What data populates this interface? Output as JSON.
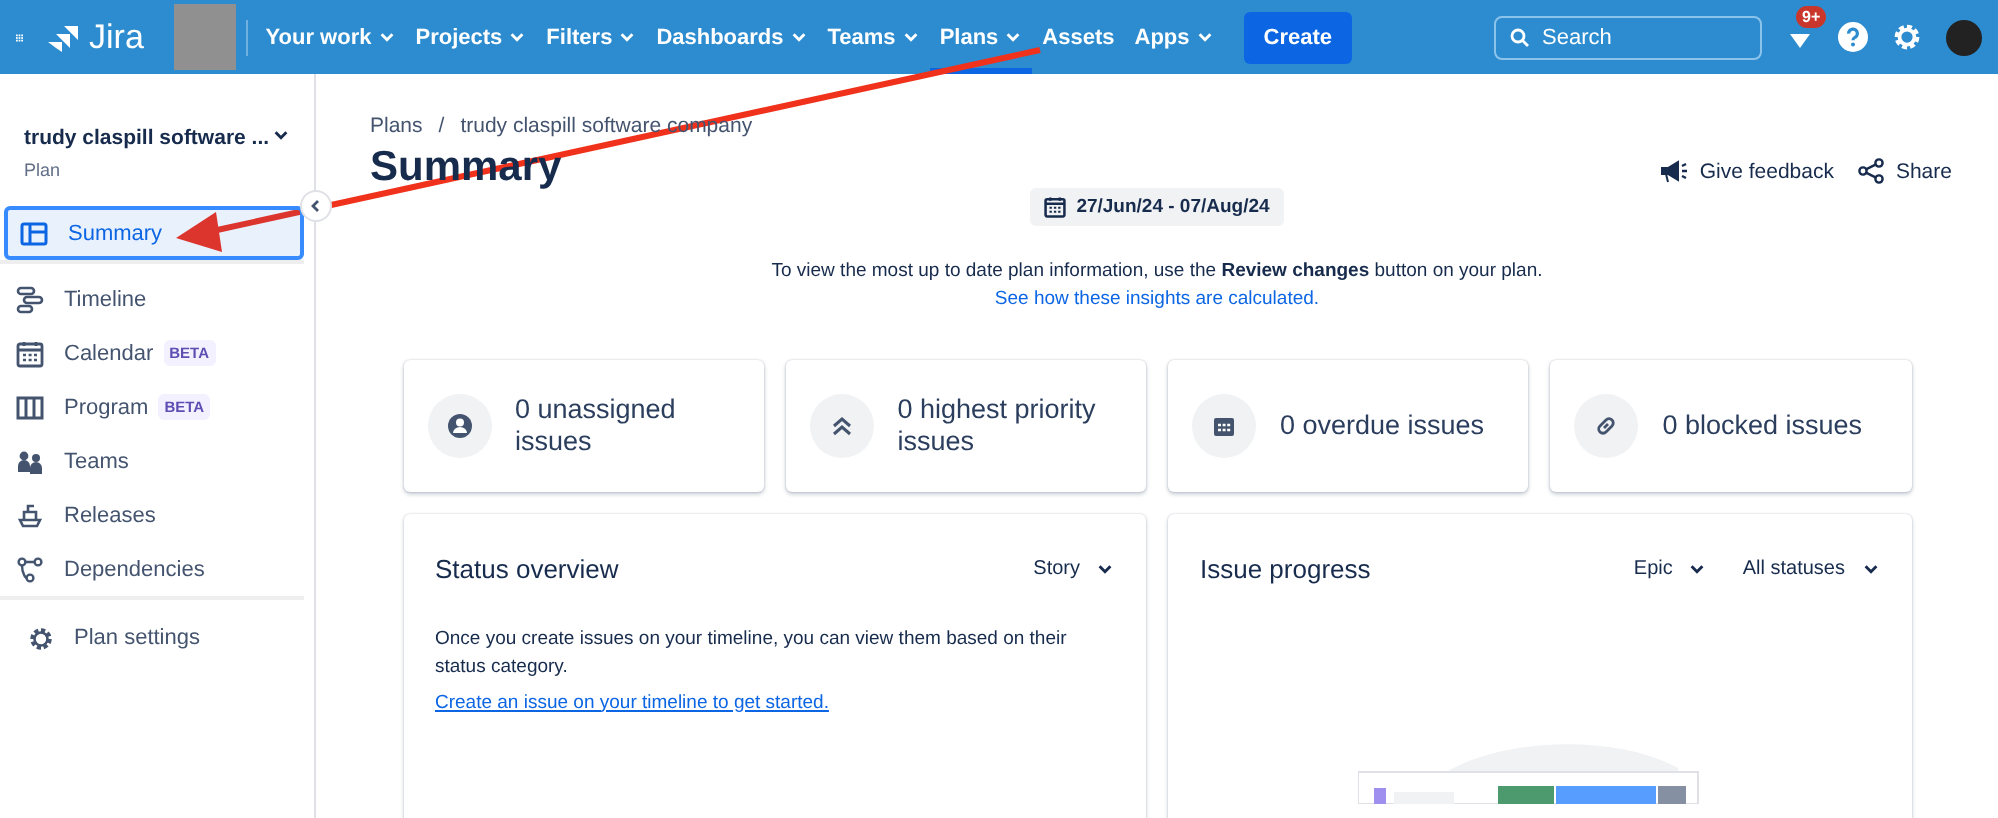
{
  "top_nav": {
    "product": "Jira",
    "menus": [
      {
        "label": "Your work",
        "dropdown": true,
        "selected": false
      },
      {
        "label": "Projects",
        "dropdown": true,
        "selected": false
      },
      {
        "label": "Filters",
        "dropdown": true,
        "selected": false
      },
      {
        "label": "Dashboards",
        "dropdown": true,
        "selected": false
      },
      {
        "label": "Teams",
        "dropdown": true,
        "selected": false
      },
      {
        "label": "Plans",
        "dropdown": true,
        "selected": true
      },
      {
        "label": "Assets",
        "dropdown": false,
        "selected": false
      },
      {
        "label": "Apps",
        "dropdown": true,
        "selected": false
      }
    ],
    "create": "Create",
    "search": {
      "placeholder": "Search"
    },
    "notification_badge": "9+"
  },
  "sidebar": {
    "plan_name": "trudy claspill software ...",
    "plan_type": "Plan",
    "items": [
      {
        "label": "Summary",
        "selected": true
      },
      {
        "label": "Timeline",
        "selected": false
      },
      {
        "label": "Calendar",
        "badge": "BETA",
        "selected": false
      },
      {
        "label": "Program",
        "badge": "BETA",
        "selected": false
      },
      {
        "label": "Teams",
        "selected": false
      },
      {
        "label": "Releases",
        "selected": false
      },
      {
        "label": "Dependencies",
        "selected": false
      }
    ],
    "settings": "Plan settings"
  },
  "breadcrumbs": [
    "Plans",
    "trudy claspill software company"
  ],
  "breadcrumb_separator": "/",
  "page_title": "Summary",
  "actions": [
    "Give feedback",
    "Share"
  ],
  "date_range": "27/Jun/24 - 07/Aug/24",
  "info": "To view the most up to date plan information, use the **Review changes** button on your plan.",
  "info_link": "See how these insights are calculated.",
  "stats": [
    {
      "text": "0 unassigned issues"
    },
    {
      "text": "0 highest priority issues"
    },
    {
      "text": "0 overdue issues"
    },
    {
      "text": "0 blocked issues"
    }
  ],
  "panels": [
    {
      "title": "Status overview",
      "filters": [
        "Story"
      ],
      "message": "Once you create issues on your timeline, you can view them based on their status category.",
      "link": "Create an issue on your timeline to get started."
    },
    {
      "title": "Issue progress",
      "filters": [
        "Epic",
        "All statuses"
      ]
    }
  ]
}
